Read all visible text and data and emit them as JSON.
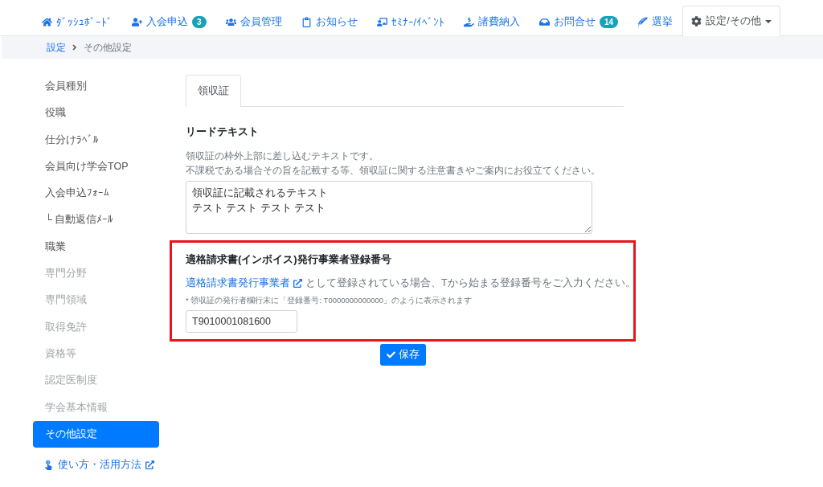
{
  "nav": {
    "items": [
      {
        "label": "ﾀﾞｯｼｭﾎﾞｰﾄﾞ",
        "selected": false
      },
      {
        "label": "入会申込",
        "badge": "3",
        "selected": false
      },
      {
        "label": "会員管理",
        "selected": false
      },
      {
        "label": "お知らせ",
        "selected": false
      },
      {
        "label": "ｾﾐﾅｰ/ｲﾍﾞﾝﾄ",
        "selected": false
      },
      {
        "label": "諸費納入",
        "selected": false
      },
      {
        "label": "お問合せ",
        "badge": "14",
        "selected": false
      },
      {
        "label": "選挙",
        "selected": false
      },
      {
        "label": "設定/その他",
        "selected": true,
        "dropdown": true
      }
    ]
  },
  "breadcrumb": {
    "link": "設定",
    "current": "その他設定"
  },
  "sidebar": {
    "items": [
      {
        "label": "会員種別",
        "disabled": false,
        "selected": false
      },
      {
        "label": "役職",
        "disabled": false,
        "selected": false
      },
      {
        "label": "仕分けﾗﾍﾞﾙ",
        "disabled": false,
        "selected": false
      },
      {
        "label": "会員向け学会TOP",
        "disabled": false,
        "selected": false
      },
      {
        "label": "入会申込ﾌｫｰﾑ",
        "disabled": false,
        "selected": false
      },
      {
        "label": "└ 自動返信ﾒｰﾙ",
        "disabled": false,
        "selected": false
      },
      {
        "label": "職業",
        "disabled": false,
        "selected": false
      },
      {
        "label": "専門分野",
        "disabled": true,
        "selected": false
      },
      {
        "label": "専門領域",
        "disabled": true,
        "selected": false
      },
      {
        "label": "取得免許",
        "disabled": true,
        "selected": false
      },
      {
        "label": "資格等",
        "disabled": true,
        "selected": false
      },
      {
        "label": "認定医制度",
        "disabled": true,
        "selected": false
      },
      {
        "label": "学会基本情報",
        "disabled": true,
        "selected": false
      },
      {
        "label": "その他設定",
        "disabled": false,
        "selected": true
      }
    ],
    "help_link": "使い方・活用方法"
  },
  "tabs": [
    {
      "label": "領収証",
      "selected": true
    }
  ],
  "lead_text": {
    "title": "リードテキスト",
    "description": [
      "領収証の枠外上部に差し込むテキストです。",
      "不課税である場合その旨を記載する等、領収証に関する注意書きやご案内にお役立てください。"
    ],
    "lines": [
      "領収証に記載されるテキスト",
      "テスト テスト テスト テスト"
    ]
  },
  "invoice": {
    "highlighted": true,
    "title": "適格請求書(インボイス)発行事業者登録番号",
    "link": "適格請求書発行事業者",
    "description": "として登録されている場合、Tから始まる登録番号をご入力ください。",
    "note": "* 領収証の発行者欄行末に「登録番号: T0000000000000」のように表示されます",
    "value": "T9010001081600"
  },
  "save_button": "保存"
}
